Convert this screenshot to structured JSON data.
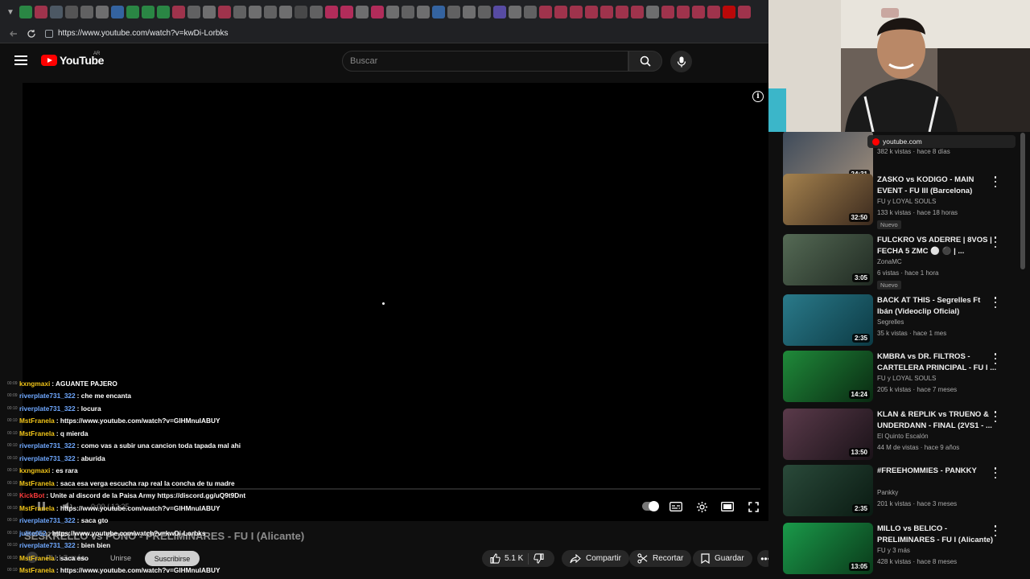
{
  "browser": {
    "url": "https://www.youtube.com/watch?v=kwDi-Lorbks",
    "tab_colors": [
      "#2da84f",
      "#c9395a",
      "#5b6b7a",
      "#666",
      "#777",
      "#888",
      "#3b7ac9",
      "#2da84f",
      "#2da84f",
      "#2da84f",
      "#c9395a",
      "#777",
      "#888",
      "#c9395a",
      "#777",
      "#888",
      "#777",
      "#888",
      "#555",
      "#777",
      "#e1306c",
      "#e1306c",
      "#888",
      "#e1306c",
      "#888",
      "#777",
      "#888",
      "#3b7ac9",
      "#777",
      "#888",
      "#777",
      "#6a5acd",
      "#888",
      "#777",
      "#c9395a",
      "#c9395a",
      "#c9395a",
      "#c9395a",
      "#c9395a",
      "#c9395a",
      "#c9395a",
      "#888",
      "#c9395a",
      "#c9395a",
      "#c9395a",
      "#c9395a",
      "#e00",
      "#c9395a"
    ]
  },
  "header": {
    "logo_text": "YouTube",
    "country": "AR",
    "search_placeholder": "Buscar"
  },
  "player": {
    "time": "0:00 / 12:25",
    "progress": 0
  },
  "video": {
    "title": "SESKRELLO vs PONO - PRELIMINARES - FU I (Alicante)",
    "channel": "FU I",
    "subscribers": "3 más",
    "join_label": "Unirse",
    "subscribe_label": "Suscribirse",
    "likes": "5.1 K",
    "share_label": "Compartir",
    "clip_label": "Recortar",
    "save_label": "Guardar"
  },
  "chat": [
    {
      "time": "00:09",
      "user": "kxngmaxi",
      "color": "#f0c419",
      "msg": ": AGUANTE PAJERO"
    },
    {
      "time": "00:09",
      "user": "riverplate731_322",
      "color": "#6fa8ff",
      "msg": ": che me encanta"
    },
    {
      "time": "00:10",
      "user": "riverplate731_322",
      "color": "#6fa8ff",
      "msg": ": locura"
    },
    {
      "time": "00:10",
      "user": "MstFranela",
      "color": "#f0c419",
      "msg": ": https://www.youtube.com/watch?v=GIHMnuIABUY"
    },
    {
      "time": "00:10",
      "user": "MstFranela",
      "color": "#f0c419",
      "msg": ": q mierda"
    },
    {
      "time": "00:10",
      "user": "riverplate731_322",
      "color": "#6fa8ff",
      "msg": ": como vas a subir una cancion toda tapada mal ahi"
    },
    {
      "time": "00:10",
      "user": "riverplate731_322",
      "color": "#6fa8ff",
      "msg": ": aburida"
    },
    {
      "time": "00:10",
      "user": "kxngmaxi",
      "color": "#f0c419",
      "msg": ": es rara"
    },
    {
      "time": "00:10",
      "user": "MstFranela",
      "color": "#f0c419",
      "msg": ": saca esa verga escucha rap real la concha de tu madre"
    },
    {
      "time": "00:10",
      "user": "KickBot",
      "color": "#ff3b3b",
      "msg": ": Unite al discord de la Paisa Army https://discord.gg/uQ9t9Dnt"
    },
    {
      "time": "00:10",
      "user": "MstFranela",
      "color": "#f0c419",
      "msg": ": https://www.youtube.com/watch?v=GIHMnuIABUY"
    },
    {
      "time": "00:10",
      "user": "riverplate731_322",
      "color": "#6fa8ff",
      "msg": ": saca gto"
    },
    {
      "time": "00:10",
      "user": "julito052",
      "color": "#6fa8ff",
      "msg": ": https://www.youtube.com/watch?v=kwDi-Lorbks"
    },
    {
      "time": "00:10",
      "user": "riverplate731_322",
      "color": "#6fa8ff",
      "msg": ": bien bien"
    },
    {
      "time": "00:10",
      "user": "MstFranela",
      "color": "#f0c419",
      "msg": ": saca eso"
    },
    {
      "time": "00:10",
      "user": "MstFranela",
      "color": "#f0c419",
      "msg": ": https://www.youtube.com/watch?v=GIHMnuIABUY"
    }
  ],
  "overlay": {
    "url_chip": "youtube.com"
  },
  "recommendations": [
    {
      "title": "",
      "channel": "",
      "meta": "382 k vistas · hace 8 días",
      "badge": "",
      "duration": "24:31",
      "colors": [
        "#3d4a5a",
        "#9a8a7a"
      ]
    },
    {
      "title": "ZASKO vs KODIGO - MAIN EVENT - FU III (Barcelona)",
      "channel": "FU y LOYAL SOULS",
      "meta": "133 k vistas · hace 18 horas",
      "badge": "Nuevo",
      "duration": "32:50",
      "colors": [
        "#a5824e",
        "#3b2a1e"
      ]
    },
    {
      "title": "FULCKRO VS ADERRE | 8VOS | FECHA 5 ZMC ⚪ ⚫ | ...",
      "channel": "ZonaMC",
      "meta": "6 vistas · hace 1 hora",
      "badge": "Nuevo",
      "duration": "3:05",
      "colors": [
        "#556a55",
        "#202a22"
      ]
    },
    {
      "title": "BACK AT THIS - Segrelles Ft Ibán (Videoclip Oficial)",
      "channel": "Segrelles",
      "meta": "35 k vistas · hace 1 mes",
      "badge": "",
      "duration": "2:35",
      "colors": [
        "#2a7a8a",
        "#0c3a44"
      ]
    },
    {
      "title": "KMBRA vs DR. FILTROS - CARTELERA PRINCIPAL - FU I ...",
      "channel": "FU y LOYAL SOULS",
      "meta": "205 k vistas · hace 7 meses",
      "badge": "",
      "duration": "14:24",
      "colors": [
        "#1f8a3a",
        "#0a2a12"
      ]
    },
    {
      "title": "KLAN & REPLIK vs TRUENO & UNDERDANN - FINAL (2VS1 - ...",
      "channel": "El Quinto Escalón",
      "meta": "44 M de vistas · hace 9 años",
      "badge": "",
      "duration": "13:50",
      "colors": [
        "#5a3a4a",
        "#1a1218"
      ]
    },
    {
      "title": "#FREEHOMMIES - PANKKY",
      "channel": "Pankky",
      "meta": "201 k vistas · hace 3 meses",
      "badge": "",
      "duration": "2:35",
      "colors": [
        "#2a4a3a",
        "#0a1a12"
      ]
    },
    {
      "title": "MILLO vs BELICO - PRELIMINARES - FU I (Alicante)",
      "channel": "FU y 3 más",
      "meta": "428 k vistas · hace 8 meses",
      "badge": "",
      "duration": "13:05",
      "colors": [
        "#1a9a4a",
        "#0a3a1a"
      ]
    }
  ]
}
